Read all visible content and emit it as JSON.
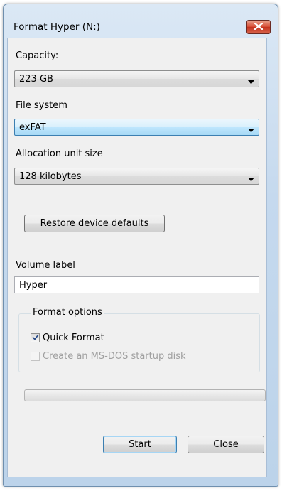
{
  "window": {
    "title": "Format Hyper (N:)"
  },
  "capacity": {
    "label": "Capacity:",
    "value": "223 GB"
  },
  "file_system": {
    "label": "File system",
    "value": "exFAT"
  },
  "allocation": {
    "label": "Allocation unit size",
    "value": "128 kilobytes"
  },
  "restore_button": "Restore device defaults",
  "volume_label": {
    "label": "Volume label",
    "value": "Hyper"
  },
  "format_options": {
    "title": "Format options",
    "quick_format": {
      "label": "Quick Format",
      "checked": true
    },
    "msdos_startup": {
      "label": "Create an MS-DOS startup disk",
      "checked": false,
      "disabled": true
    }
  },
  "progress": {
    "percent": 0
  },
  "buttons": {
    "start": "Start",
    "close": "Close"
  },
  "icons": {
    "close": "close-x-icon",
    "dropdown": "chevron-down-icon",
    "check": "checkmark-icon"
  },
  "colors": {
    "close_button": "#c3321e",
    "focus_border": "#3c7fb1",
    "client_bg": "#f0f0f0"
  }
}
